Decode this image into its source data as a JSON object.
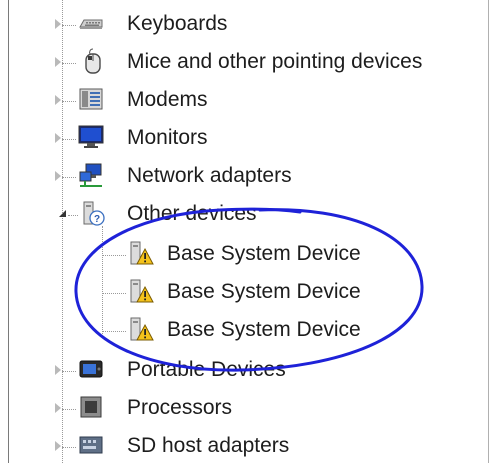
{
  "tree": {
    "items": [
      {
        "label": "Keyboards",
        "icon": "keyboard-icon"
      },
      {
        "label": "Mice and other pointing devices",
        "icon": "mouse-icon"
      },
      {
        "label": "Modems",
        "icon": "modem-icon"
      },
      {
        "label": "Monitors",
        "icon": "monitor-icon"
      },
      {
        "label": "Network adapters",
        "icon": "network-adapter-icon"
      },
      {
        "label": "Other devices",
        "icon": "unknown-device-icon",
        "expanded": true,
        "children": [
          {
            "label": "Base System Device",
            "icon": "warning-device-icon"
          },
          {
            "label": "Base System Device",
            "icon": "warning-device-icon"
          },
          {
            "label": "Base System Device",
            "icon": "warning-device-icon"
          }
        ]
      },
      {
        "label": "Portable Devices",
        "icon": "portable-device-icon"
      },
      {
        "label": "Processors",
        "icon": "processor-icon"
      },
      {
        "label": "SD host adapters",
        "icon": "sd-host-adapter-icon"
      }
    ]
  },
  "annotation": {
    "shape": "ellipse",
    "color": "#1e22d8"
  }
}
